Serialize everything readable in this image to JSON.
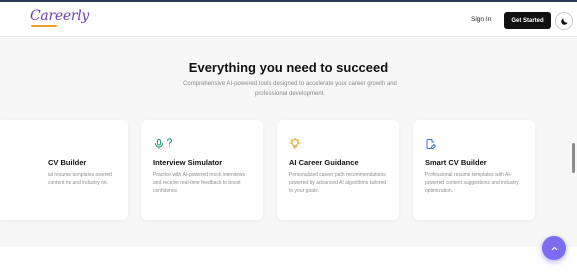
{
  "header": {
    "logo_text": "Careerly",
    "sign_in_label": "Sign In",
    "get_started_label": "Get Started",
    "toggle_icon": "moon-icon"
  },
  "hero": {
    "title": "Everything you need to succeed",
    "subtitle": "Comprehensive AI-powered tools designed to accelerate your career growth and professional development."
  },
  "cards": [
    {
      "title": "CV Builder",
      "description": "ial resume templates owered content ns and industry on.",
      "icon": "document-icon"
    },
    {
      "title": "Interview Simulator",
      "description": "Practice with AI-powered mock interviews and receive real-time feedback to boost confidence.",
      "icon": "microphone-icon",
      "icon_color": "#22a06b"
    },
    {
      "title": "AI Career Guidance",
      "description": "Personalized career path recommendations powered by advanced AI algorithms tailored to your goals.",
      "icon": "lightbulb-icon",
      "icon_color": "#e0a21a"
    },
    {
      "title": "Smart CV Builder",
      "description": "Professional resume templates with AI-powered content suggestions and industry optimization.",
      "icon": "edit-document-icon",
      "icon_color": "#3b6fd8"
    }
  ],
  "colors": {
    "brand_purple": "#6d3fb0",
    "fab": "#7b6cf1",
    "button_dark": "#111111"
  }
}
